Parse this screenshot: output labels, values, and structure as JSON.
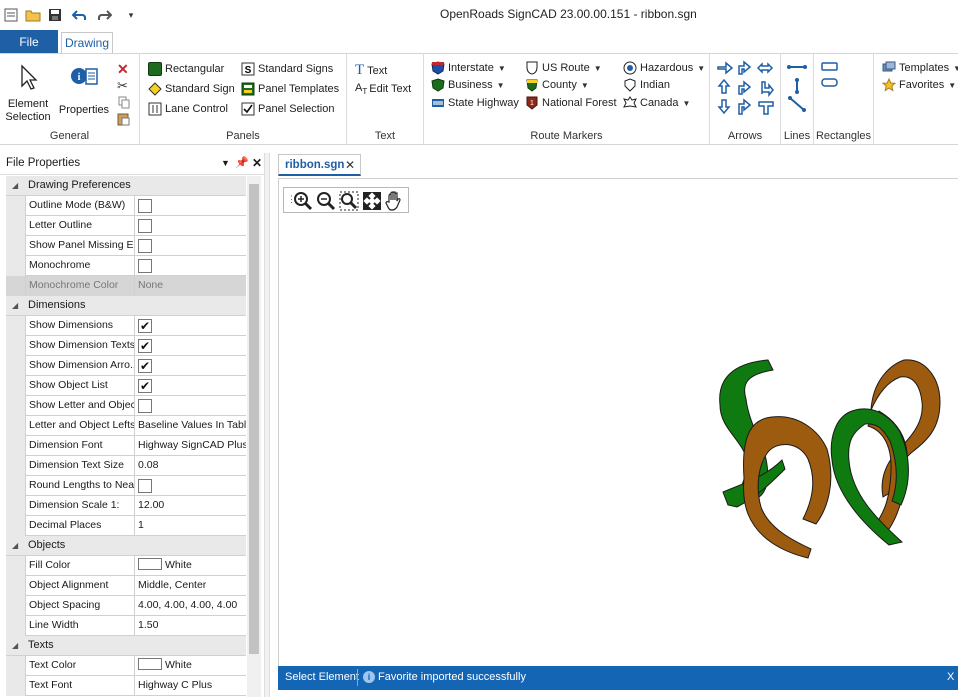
{
  "titlebar": {
    "title": "OpenRoads SignCAD 23.00.00.151 - ribbon.sgn"
  },
  "tabs": {
    "file": "File",
    "drawing": "Drawing"
  },
  "ribbon": {
    "general": {
      "label": "General",
      "element_selection": "Element Selection",
      "element_selection_l1": "Element",
      "element_selection_l2": "Selection",
      "properties": "Properties"
    },
    "panels": {
      "label": "Panels",
      "rectangular": "Rectangular",
      "standard_sign": "Standard Sign",
      "lane_control": "Lane Control",
      "standard_signs": "Standard Signs",
      "panel_templates": "Panel Templates",
      "panel_selection": "Panel Selection"
    },
    "text": {
      "label": "Text",
      "text": "Text",
      "edit_text": "Edit Text"
    },
    "route_markers": {
      "label": "Route Markers",
      "interstate": "Interstate",
      "business": "Business",
      "state_highway": "State Highway",
      "us_route": "US Route",
      "county": "County",
      "national_forest": "National Forest",
      "hazardous": "Hazardous",
      "indian": "Indian",
      "canada": "Canada"
    },
    "arrows": {
      "label": "Arrows"
    },
    "lines": {
      "label": "Lines"
    },
    "rectangles": {
      "label": "Rectangles"
    },
    "templates": {
      "templates": "Templates",
      "favorites": "Favorites"
    }
  },
  "file_properties": {
    "title": "File Properties",
    "sections": [
      {
        "name": "Drawing Preferences",
        "rows": [
          {
            "name": "Outline Mode (B&W)",
            "type": "check",
            "checked": false
          },
          {
            "name": "Letter Outline",
            "type": "check",
            "checked": false
          },
          {
            "name": "Show Panel Missing E...",
            "type": "check",
            "checked": false
          },
          {
            "name": "Monochrome",
            "type": "check",
            "checked": false
          },
          {
            "name": "Monochrome Color",
            "type": "text",
            "value": "None",
            "disabled": true
          }
        ]
      },
      {
        "name": "Dimensions",
        "rows": [
          {
            "name": "Show Dimensions",
            "type": "check",
            "checked": true
          },
          {
            "name": "Show Dimension Texts",
            "type": "check",
            "checked": true
          },
          {
            "name": "Show Dimension Arro...",
            "type": "check",
            "checked": true
          },
          {
            "name": "Show Object List",
            "type": "check",
            "checked": true
          },
          {
            "name": "Show Letter and Objec...",
            "type": "check",
            "checked": false
          },
          {
            "name": "Letter and Object Lefts...",
            "type": "text",
            "value": "Baseline Values In Tabl"
          },
          {
            "name": "Dimension Font",
            "type": "text",
            "value": "Highway SignCAD Plus"
          },
          {
            "name": "Dimension Text Size",
            "type": "text",
            "value": "0.08"
          },
          {
            "name": "Round Lengths to Nea...",
            "type": "check",
            "checked": false
          },
          {
            "name": "Dimension Scale 1:",
            "type": "text",
            "value": "12.00"
          },
          {
            "name": "Decimal Places",
            "type": "text",
            "value": "1"
          }
        ]
      },
      {
        "name": "Objects",
        "rows": [
          {
            "name": "Fill Color",
            "type": "color",
            "value": "White"
          },
          {
            "name": "Object Alignment",
            "type": "text",
            "value": "Middle, Center"
          },
          {
            "name": "Object Spacing",
            "type": "text",
            "value": "4.00, 4.00, 4.00, 4.00"
          },
          {
            "name": "Line Width",
            "type": "text",
            "value": "1.50"
          }
        ]
      },
      {
        "name": "Texts",
        "rows": [
          {
            "name": "Text Color",
            "type": "color",
            "value": "White"
          },
          {
            "name": "Text Font",
            "type": "text",
            "value": "Highway C Plus"
          }
        ]
      }
    ]
  },
  "document": {
    "tab": "ribbon.sgn",
    "close": "✕"
  },
  "status": {
    "left": "Select Element",
    "message": "Favorite imported successfully",
    "close": "X"
  },
  "colors": {
    "accent": "#1f5fa6",
    "green": "#0f7a0f",
    "brown": "#9c5b0f"
  }
}
